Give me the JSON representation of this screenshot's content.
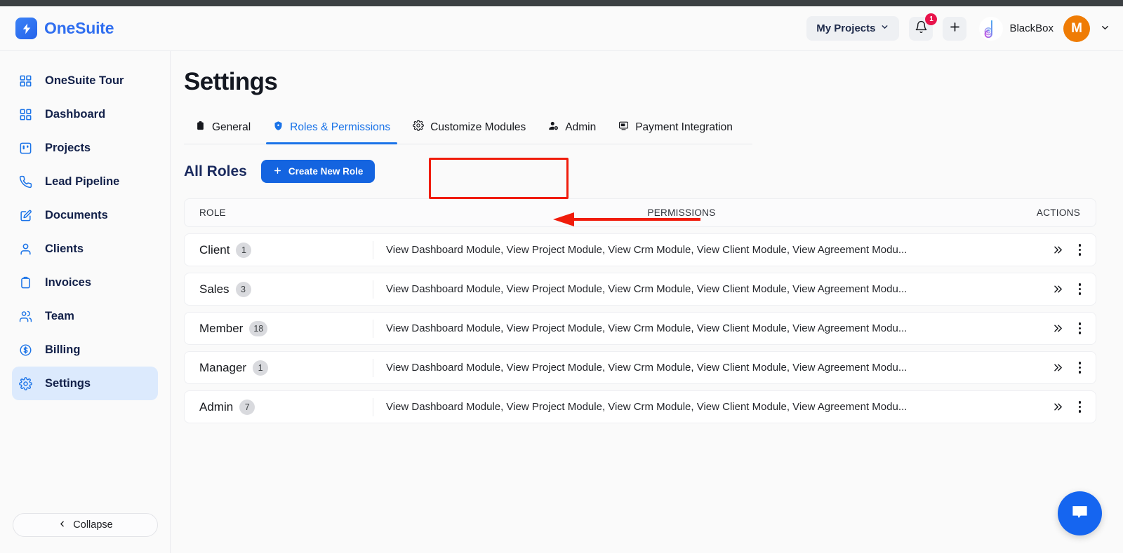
{
  "app": {
    "brand_name": "OneSuite",
    "brand_icon": "lightning-bolt-icon"
  },
  "header": {
    "projects_selector": "My Projects",
    "projects_chevron": "chevron-down-icon",
    "notification_icon": "bell-icon",
    "notification_count": "1",
    "add_icon": "plus-icon",
    "org_logo_icon": "blackbox-swirl-logo",
    "org_name": "BlackBox",
    "avatar_initial": "M",
    "account_chevron": "chevron-down-icon"
  },
  "sidebar": {
    "items": [
      {
        "label": "OneSuite Tour",
        "icon": "grid-icon",
        "active": false
      },
      {
        "label": "Dashboard",
        "icon": "grid-icon",
        "active": false
      },
      {
        "label": "Projects",
        "icon": "kanban-board-icon",
        "active": false
      },
      {
        "label": "Lead Pipeline",
        "icon": "phone-icon",
        "active": false
      },
      {
        "label": "Documents",
        "icon": "document-edit-icon",
        "active": false
      },
      {
        "label": "Clients",
        "icon": "user-icon",
        "active": false
      },
      {
        "label": "Invoices",
        "icon": "clipboard-icon",
        "active": false
      },
      {
        "label": "Team",
        "icon": "users-icon",
        "active": false
      },
      {
        "label": "Billing",
        "icon": "dollar-circle-icon",
        "active": false
      },
      {
        "label": "Settings",
        "icon": "gear-icon",
        "active": true
      }
    ],
    "collapse_label": "Collapse",
    "collapse_icon": "chevron-left-icon"
  },
  "main": {
    "page_title": "Settings",
    "tabs": [
      {
        "label": "General",
        "icon": "clipboard-icon",
        "active": false
      },
      {
        "label": "Roles & Permissions",
        "icon": "shield-icon",
        "active": true
      },
      {
        "label": "Customize Modules",
        "icon": "gear-icon",
        "active": false
      },
      {
        "label": "Admin",
        "icon": "user-shield-icon",
        "active": false
      },
      {
        "label": "Payment Integration",
        "icon": "monitor-icon",
        "active": false
      }
    ],
    "section_title": "All Roles",
    "create_button": "Create New Role",
    "create_button_icon": "plus-icon",
    "table": {
      "headers": {
        "role": "ROLE",
        "permissions": "PERMISSIONS",
        "actions": "ACTIONS"
      },
      "rows": [
        {
          "role": "Client",
          "count": "1",
          "permissions": "View Dashboard Module, View Project Module, View Crm Module, View Client Module, View Agreement Modu...",
          "expand_icon": "double-chevron-right-icon",
          "menu_icon": "vertical-dots-icon"
        },
        {
          "role": "Sales",
          "count": "3",
          "permissions": "View Dashboard Module, View Project Module, View Crm Module, View Client Module, View Agreement Modu...",
          "expand_icon": "double-chevron-right-icon",
          "menu_icon": "vertical-dots-icon"
        },
        {
          "role": "Member",
          "count": "18",
          "permissions": "View Dashboard Module, View Project Module, View Crm Module, View Client Module, View Agreement Modu...",
          "expand_icon": "double-chevron-right-icon",
          "menu_icon": "vertical-dots-icon"
        },
        {
          "role": "Manager",
          "count": "1",
          "permissions": "View Dashboard Module, View Project Module, View Crm Module, View Client Module, View Agreement Modu...",
          "expand_icon": "double-chevron-right-icon",
          "menu_icon": "vertical-dots-icon"
        },
        {
          "role": "Admin",
          "count": "7",
          "permissions": "View Dashboard Module, View Project Module, View Crm Module, View Client Module, View Agreement Modu...",
          "expand_icon": "double-chevron-right-icon",
          "menu_icon": "vertical-dots-icon"
        }
      ]
    }
  },
  "support": {
    "chat_icon": "chat-bubble-icon"
  },
  "annotations": {
    "highlight_target": "Roles & Permissions",
    "arrow_target": "Create New Role",
    "color": "#f01c0b"
  },
  "colors": {
    "accent_blue": "#1464e0",
    "brand_blue": "#2f6ef0",
    "avatar_orange": "#ef7c05",
    "badge_red": "#e8134b",
    "annotation_red": "#f01c0b"
  }
}
